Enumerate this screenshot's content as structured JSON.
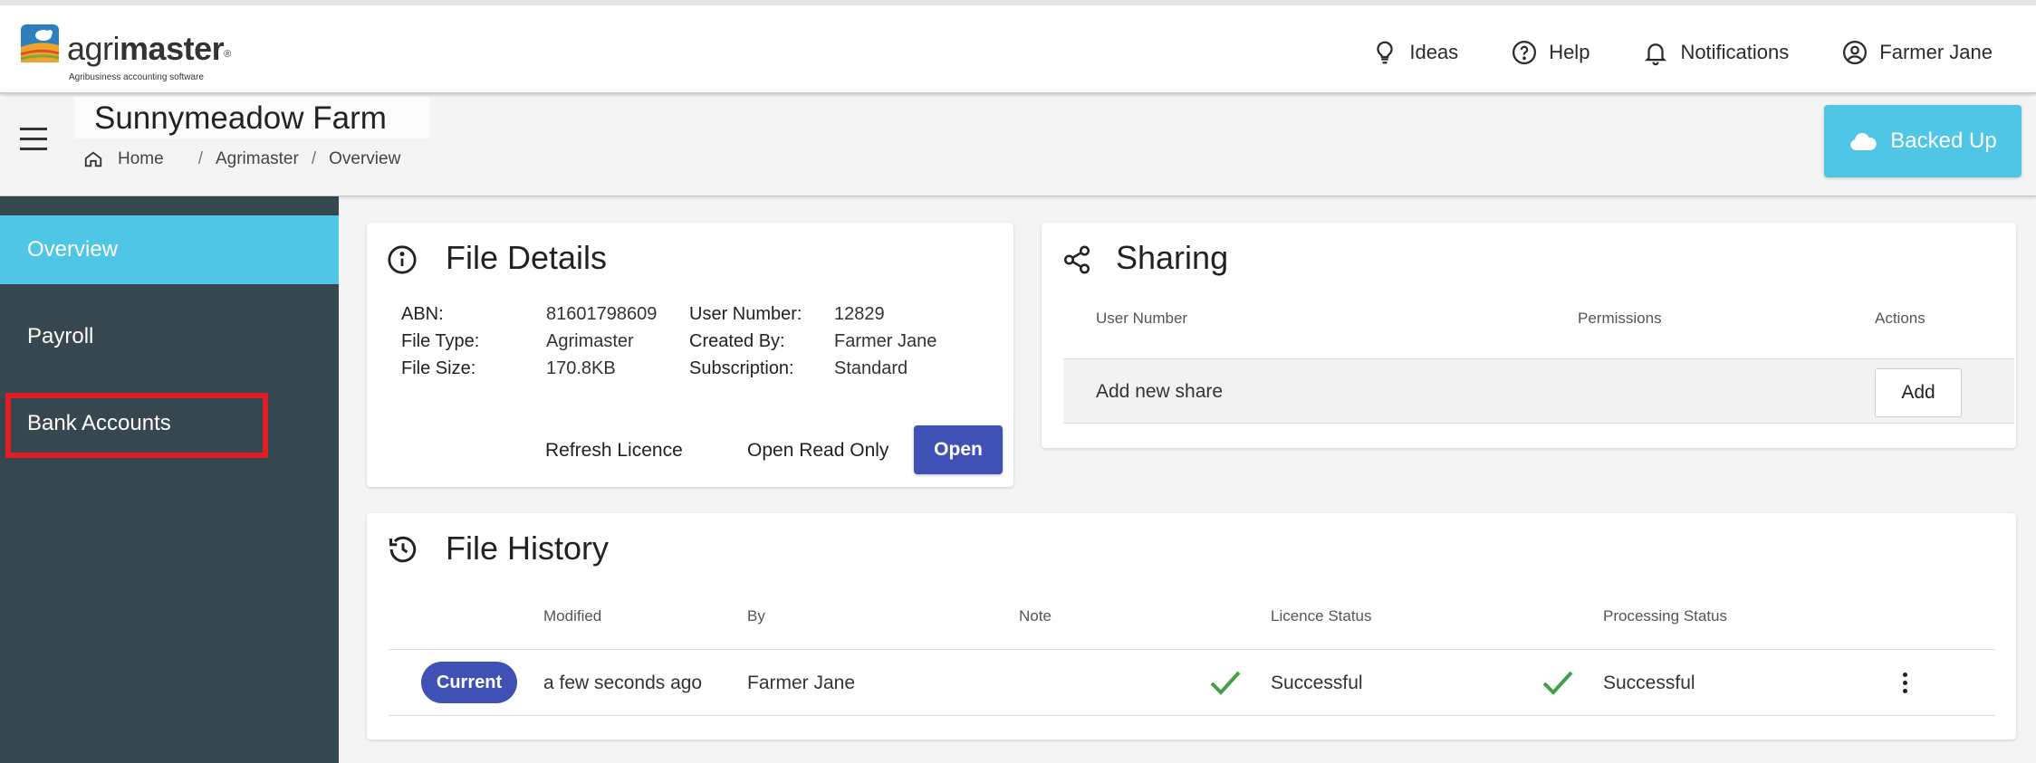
{
  "app": {
    "logo_prefix": "agri",
    "logo_bold": "master",
    "logo_reg": "®",
    "logo_tagline": "Agribusiness accounting software"
  },
  "topnav": {
    "ideas": "Ideas",
    "help": "Help",
    "notifications": "Notifications",
    "user": "Farmer Jane"
  },
  "header": {
    "title": "Sunnymeadow Farm",
    "breadcrumb": [
      "Home",
      "Agrimaster",
      "Overview"
    ],
    "breadcrumb_sep": "/",
    "backup_status": "Backed Up"
  },
  "sidebar": {
    "items": [
      {
        "label": "Overview",
        "active": true
      },
      {
        "label": "Payroll",
        "active": false
      },
      {
        "label": "Bank Accounts",
        "active": false
      }
    ]
  },
  "file_details": {
    "title": "File Details",
    "abn_label": "ABN:",
    "abn": "81601798609",
    "file_type_label": "File Type:",
    "file_type": "Agrimaster",
    "file_size_label": "File Size:",
    "file_size": "170.8KB",
    "user_number_label": "User Number:",
    "user_number": "12829",
    "created_by_label": "Created By:",
    "created_by": "Farmer Jane",
    "subscription_label": "Subscription:",
    "subscription": "Standard",
    "refresh_licence": "Refresh Licence",
    "open_read_only": "Open Read Only",
    "open": "Open"
  },
  "sharing": {
    "title": "Sharing",
    "columns": [
      "User Number",
      "Permissions",
      "Actions"
    ],
    "add_new_share": "Add new share",
    "add": "Add"
  },
  "file_history": {
    "title": "File History",
    "columns": [
      "Modified",
      "By",
      "Note",
      "Licence Status",
      "Processing Status"
    ],
    "rows": [
      {
        "badge": "Current",
        "modified": "a few seconds ago",
        "by": "Farmer Jane",
        "note": "",
        "licence_status": "Successful",
        "processing_status": "Successful"
      }
    ]
  },
  "colors": {
    "accent": "#4fc6e6",
    "primary": "#3f51b5",
    "sidebar": "#37474f",
    "success": "#43a047",
    "highlight": "#e01e26"
  }
}
